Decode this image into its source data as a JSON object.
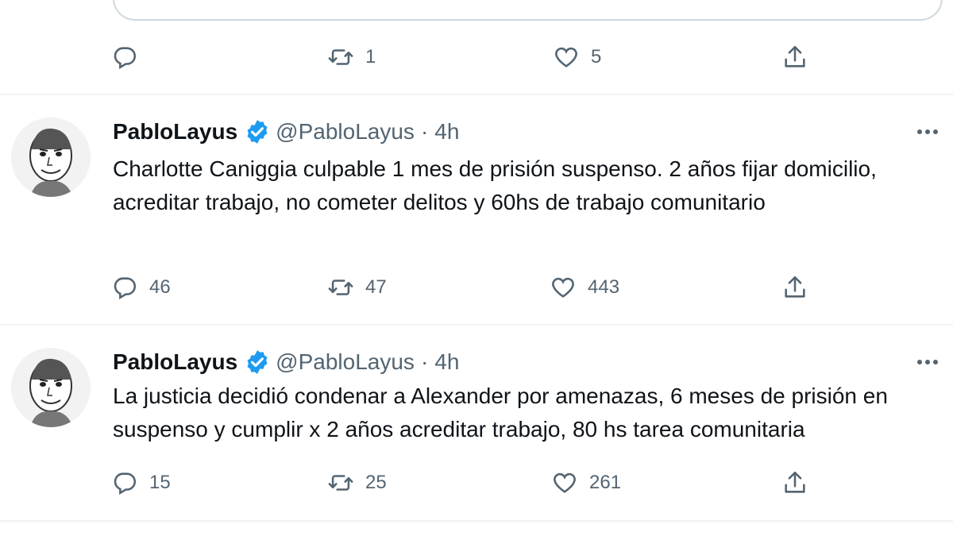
{
  "previous_tweet": {
    "actions": {
      "reply_count": "",
      "retweet_count": "1",
      "like_count": "5"
    }
  },
  "tweets": [
    {
      "author_name": "PabloLayus",
      "handle": "@PabloLayus",
      "separator": "·",
      "time": "4h",
      "text": "Charlotte Caniggia culpable 1 mes de prisión suspenso. 2 años fijar domicilio, acreditar trabajo, no cometer delitos y 60hs de trabajo comunitario",
      "reply_count": "46",
      "retweet_count": "47",
      "like_count": "443"
    },
    {
      "author_name": "PabloLayus",
      "handle": "@PabloLayus",
      "separator": "·",
      "time": "4h",
      "text": "La justicia decidió condenar a Alexander por amenazas, 6 meses de prisión en suspenso y cumplir x 2 años acreditar trabajo, 80 hs tarea comunitaria",
      "reply_count": "15",
      "retweet_count": "25",
      "like_count": "261"
    }
  ],
  "icons": {
    "reply": "reply-icon",
    "retweet": "retweet-icon",
    "like": "heart-icon",
    "share": "share-icon",
    "verified": "verified-badge-icon",
    "more": "more-options-icon"
  },
  "colors": {
    "text": "#0f1419",
    "secondary": "#536471",
    "verified": "#1d9bf0",
    "divider": "#eff3f4"
  }
}
